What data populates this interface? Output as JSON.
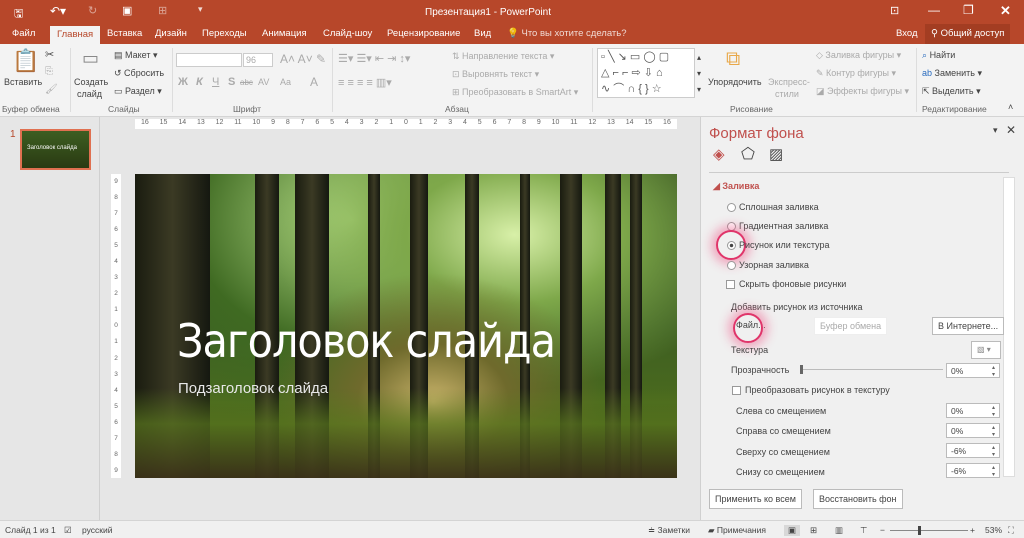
{
  "titlebar": {
    "title": "Презентация1 - PowerPoint",
    "icons": [
      "save-icon",
      "undo-icon",
      "redo-icon",
      "slideshow-icon",
      "touch-mode-icon",
      "customize-icon"
    ],
    "window_buttons": [
      "ribbon-options-icon",
      "minimize-icon",
      "restore-icon",
      "close-icon"
    ]
  },
  "tabs": [
    "Файл",
    "Главная",
    "Вставка",
    "Дизайн",
    "Переходы",
    "Анимация",
    "Слайд-шоу",
    "Рецензирование",
    "Вид"
  ],
  "tell_me": "Что вы хотите сделать?",
  "signin": "Вход",
  "share": "Общий доступ",
  "ribbon": {
    "clipboard": {
      "label": "Буфер обмена",
      "paste": "Вставить"
    },
    "slides": {
      "label": "Слайды",
      "new_slide_1": "Создать",
      "new_slide_2": "слайд",
      "layout": "Макет",
      "reset": "Сбросить",
      "section": "Раздел"
    },
    "font": {
      "label": "Шрифт",
      "font_name": "",
      "font_size": "96",
      "bold": "Ж",
      "italic": "К",
      "underline": "Ч",
      "shadow": "S",
      "strike": "abc",
      "spacing": "AV",
      "case": "Aa",
      "color": "A"
    },
    "paragraph": {
      "label": "Абзац",
      "text_direction": "Направление текста",
      "align_text": "Выровнять текст",
      "smartart": "Преобразовать в SmartArt"
    },
    "drawing": {
      "label": "Рисование",
      "arrange": "Упорядочить",
      "styles_1": "Экспресс-",
      "styles_2": "стили",
      "fill": "Заливка фигуры",
      "outline": "Контур фигуры",
      "effects": "Эффекты фигуры"
    },
    "editing": {
      "label": "Редактирование",
      "find": "Найти",
      "replace": "Заменить",
      "select": "Выделить"
    }
  },
  "thumbnails": [
    {
      "number": "1",
      "title": "Заголовок слайда"
    }
  ],
  "ruler": [
    "16",
    "15",
    "14",
    "13",
    "12",
    "11",
    "10",
    "9",
    "8",
    "7",
    "6",
    "5",
    "4",
    "3",
    "2",
    "1",
    "0",
    "1",
    "2",
    "3",
    "4",
    "5",
    "6",
    "7",
    "8",
    "9",
    "10",
    "11",
    "12",
    "13",
    "14",
    "15",
    "16"
  ],
  "vruler": [
    "9",
    "8",
    "7",
    "6",
    "5",
    "4",
    "3",
    "2",
    "1",
    "0",
    "1",
    "2",
    "3",
    "4",
    "5",
    "6",
    "7",
    "8",
    "9"
  ],
  "slide": {
    "title": "Заголовок слайда",
    "subtitle": "Подзаголовок слайда"
  },
  "pane": {
    "title": "Формат фона",
    "section": "Заливка",
    "options": [
      {
        "label": "Сплошная заливка",
        "selected": false
      },
      {
        "label": "Градиентная заливка",
        "selected": false
      },
      {
        "label": "Рисунок или текстура",
        "selected": true
      },
      {
        "label": "Узорная заливка",
        "selected": false
      }
    ],
    "hide_bg": {
      "label": "Скрыть фоновые рисунки",
      "checked": false
    },
    "insert_from": "Добавить рисунок из источника",
    "file_btn": "Файл...",
    "clipboard_btn": "Буфер обмена",
    "online_btn": "В Интернете...",
    "texture": "Текстура",
    "transparency": {
      "label": "Прозрачность",
      "value": "0%"
    },
    "tile": {
      "label": "Преобразовать рисунок в текстуру",
      "checked": false
    },
    "offsets": [
      {
        "label": "Слева со смещением",
        "value": "0%"
      },
      {
        "label": "Справа со смещением",
        "value": "0%"
      },
      {
        "label": "Сверху со смещением",
        "value": "-6%"
      },
      {
        "label": "Снизу со смещением",
        "value": "-6%"
      }
    ],
    "apply_all": "Применить ко всем",
    "reset_bg": "Восстановить фон"
  },
  "status": {
    "slide": "Слайд 1 из 1",
    "language": "русский",
    "notes": "Заметки",
    "comments": "Примечания",
    "zoom": "53%",
    "zoom_percent": 53
  },
  "colors": {
    "accent": "#b7472a",
    "highlight": "#e0356a"
  }
}
